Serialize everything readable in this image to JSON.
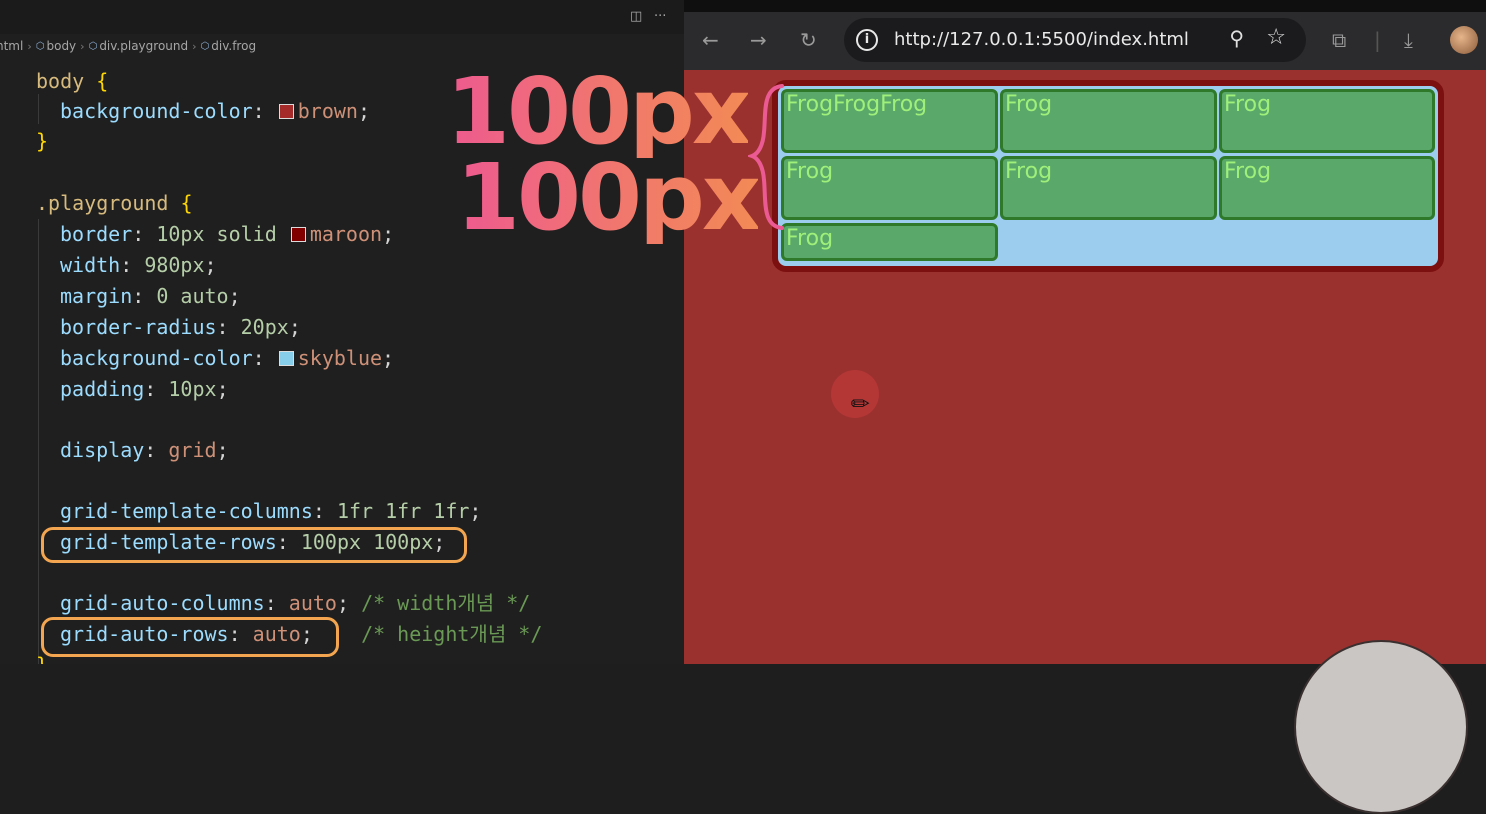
{
  "breadcrumb": {
    "items": [
      "html",
      "body",
      "div.playground",
      "div.frog"
    ]
  },
  "code": {
    "body_selector": "body",
    "body_bg_prop": "background-color",
    "body_bg_value": "brown",
    "playground_selector": ".playground",
    "border_prop": "border",
    "border_value": "10px solid",
    "border_color": "maroon",
    "width_prop": "width",
    "width_value": "980px",
    "margin_prop": "margin",
    "margin_value": "0 auto",
    "radius_prop": "border-radius",
    "radius_value": "20px",
    "bg_prop": "background-color",
    "bg_value": "skyblue",
    "padding_prop": "padding",
    "padding_value": "10px",
    "display_prop": "display",
    "display_value": "grid",
    "gtc_prop": "grid-template-columns",
    "gtc_value": "1fr 1fr 1fr",
    "gtr_prop": "grid-template-rows",
    "gtr_value": "100px 100px",
    "gac_prop": "grid-auto-columns",
    "gac_value": "auto",
    "gac_comment": "/* width개념 */",
    "gar_prop": "grid-auto-rows",
    "gar_value": "auto",
    "gar_comment": "/* height개념 */"
  },
  "swatch_colors": {
    "brown": "#a52a2a",
    "maroon": "#800000",
    "skyblue": "#87ceeb"
  },
  "browser": {
    "url": "http://127.0.0.1:5500/index.html",
    "icons": [
      "back-icon",
      "forward-icon",
      "reload-icon",
      "info-icon",
      "zoom-icon",
      "star-icon",
      "extensions-icon",
      "download-icon",
      "avatar"
    ]
  },
  "frogs": [
    "FrogFrogFrog",
    "Frog",
    "Frog",
    "Frog",
    "Frog",
    "Frog",
    "Frog"
  ],
  "overlay": {
    "label_row1": "100px",
    "label_row2": "100px"
  }
}
